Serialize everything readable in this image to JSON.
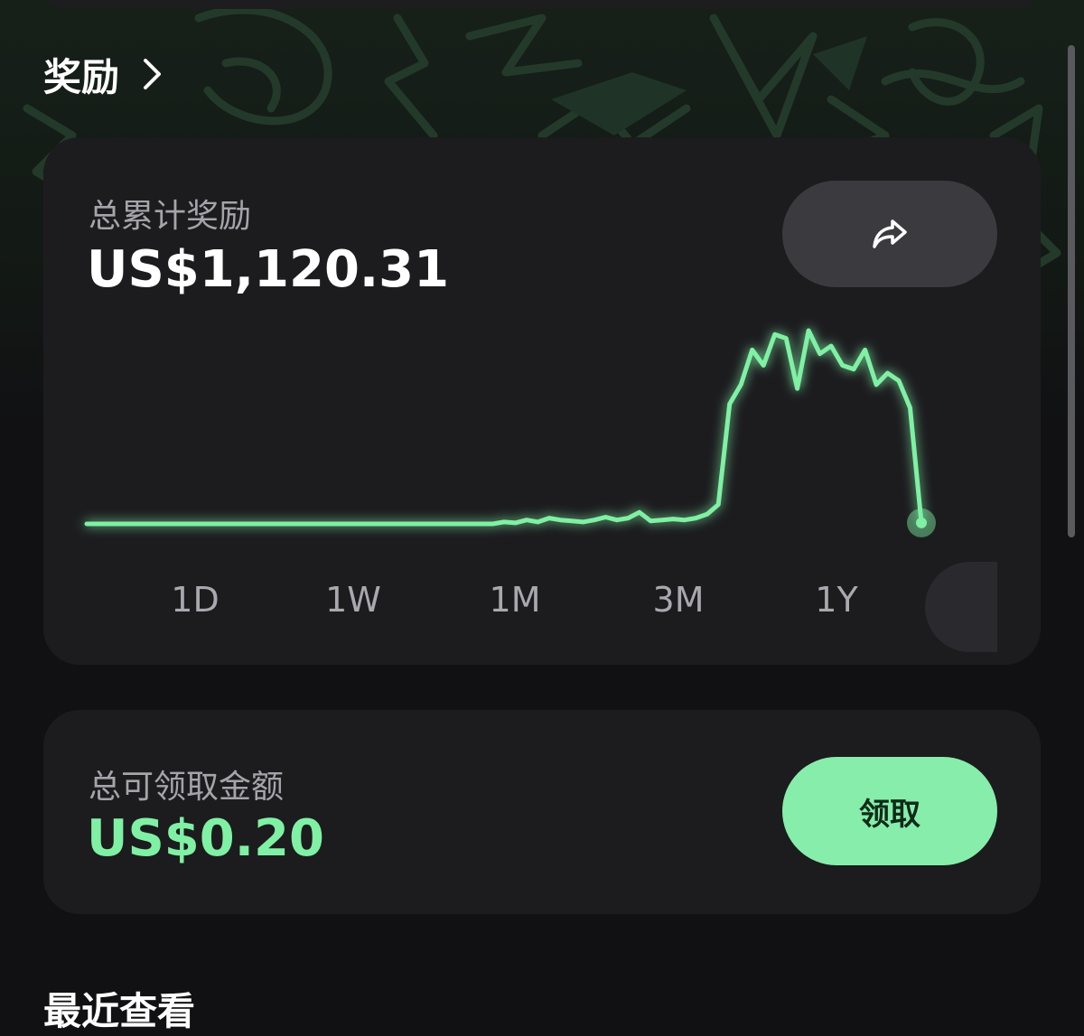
{
  "header": {
    "title": "奖励"
  },
  "rewards_card": {
    "label": "总累计奖励",
    "value": "US$1,120.31",
    "share_icon": "share-icon"
  },
  "range_tabs": [
    "1D",
    "1W",
    "1M",
    "3M",
    "1Y"
  ],
  "claim_card": {
    "label": "总可领取金额",
    "value": "US$0.20",
    "button_label": "领取"
  },
  "recent": {
    "title": "最近查看"
  },
  "colors": {
    "accent": "#86eeaa",
    "line": "#7ff0a4",
    "card": "#1c1c1f",
    "background": "#111113"
  },
  "chart_data": {
    "type": "line",
    "series": [
      {
        "values": [
          0,
          0,
          0,
          0,
          0,
          0,
          0,
          0,
          0,
          0,
          0,
          0,
          0,
          0,
          0,
          0,
          0,
          0,
          0,
          0,
          0,
          0,
          0,
          0,
          0,
          0,
          0,
          0,
          0,
          0,
          0,
          0,
          0,
          0,
          0,
          0,
          0,
          0.01,
          0.005,
          0.02,
          0.01,
          0.03,
          0.02,
          0.015,
          0.01,
          0.02,
          0.035,
          0.02,
          0.03,
          0.06,
          0.015,
          0.02,
          0.025,
          0.02,
          0.03,
          0.05,
          0.1,
          0.62,
          0.72,
          0.9,
          0.82,
          0.98,
          0.96,
          0.7,
          1.0,
          0.88,
          0.92,
          0.82,
          0.8,
          0.9,
          0.72,
          0.78,
          0.74,
          0.6,
          0.005
        ]
      }
    ]
  }
}
